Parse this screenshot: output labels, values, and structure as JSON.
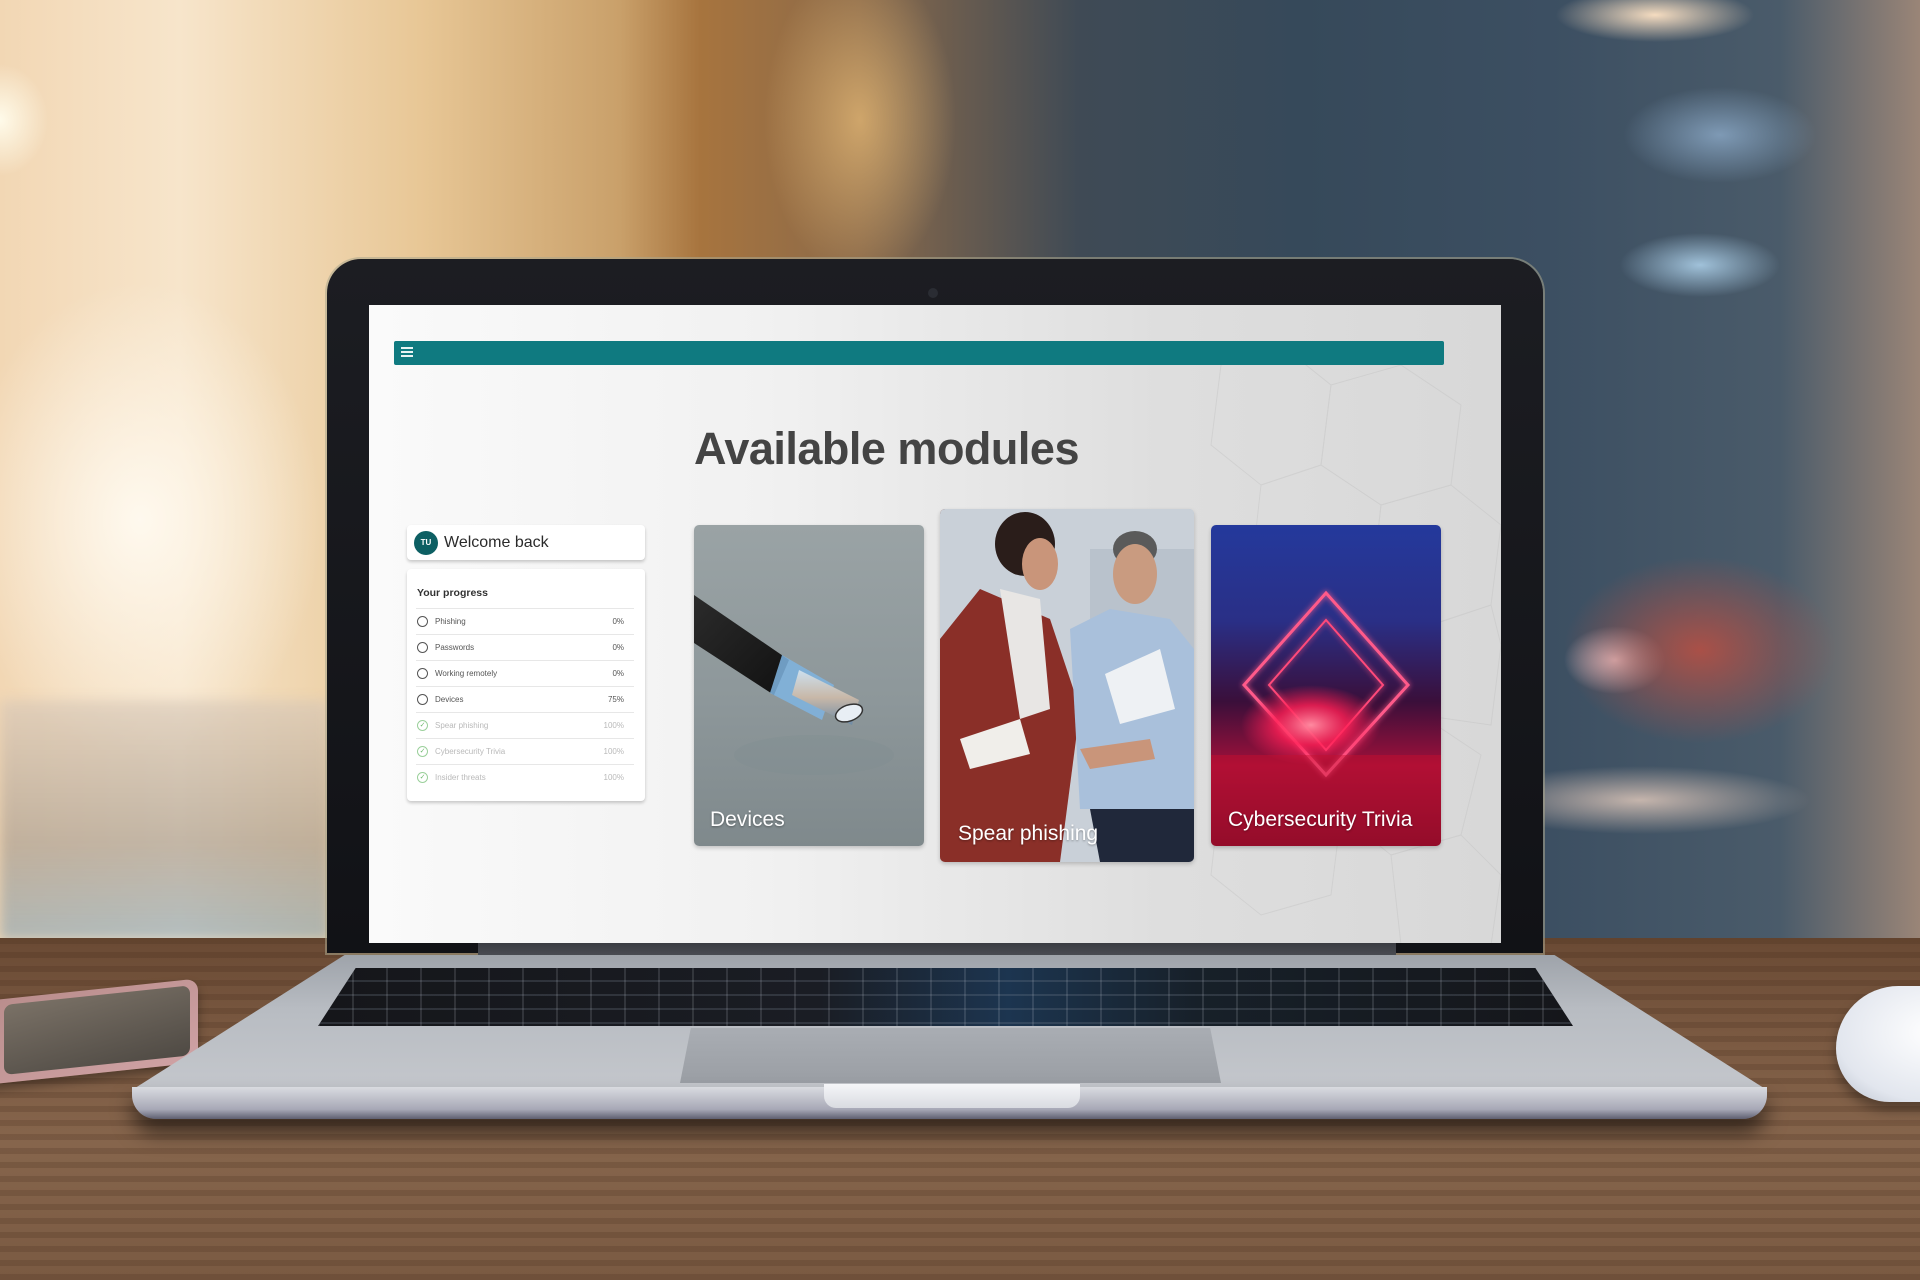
{
  "app": {
    "menu_icon": "hamburger-menu-icon",
    "accent_color": "#0f7a80",
    "page_title": "Available modules"
  },
  "user": {
    "avatar_initials": "TU",
    "greeting": "Welcome back"
  },
  "progress": {
    "title": "Your progress",
    "items": [
      {
        "label": "Phishing",
        "percent": "0%",
        "status": "incomplete",
        "icon": "empty-circle-icon"
      },
      {
        "label": "Passwords",
        "percent": "0%",
        "status": "incomplete",
        "icon": "empty-circle-icon"
      },
      {
        "label": "Working remotely",
        "percent": "0%",
        "status": "incomplete",
        "icon": "empty-circle-icon"
      },
      {
        "label": "Devices",
        "percent": "75%",
        "status": "incomplete",
        "icon": "empty-circle-icon"
      },
      {
        "label": "Spear phishing",
        "percent": "100%",
        "status": "complete",
        "icon": "check-circle-icon"
      },
      {
        "label": "Cybersecurity Trivia",
        "percent": "100%",
        "status": "complete",
        "icon": "check-circle-icon"
      },
      {
        "label": "Insider threats",
        "percent": "100%",
        "status": "complete",
        "icon": "check-circle-icon"
      }
    ]
  },
  "modules": [
    {
      "label": "Devices",
      "image": "usb-c-cable-photo"
    },
    {
      "label": "Spear phishing",
      "image": "office-colleagues-photo"
    },
    {
      "label": "Cybersecurity Trivia",
      "image": "neon-diamond-photo"
    }
  ]
}
